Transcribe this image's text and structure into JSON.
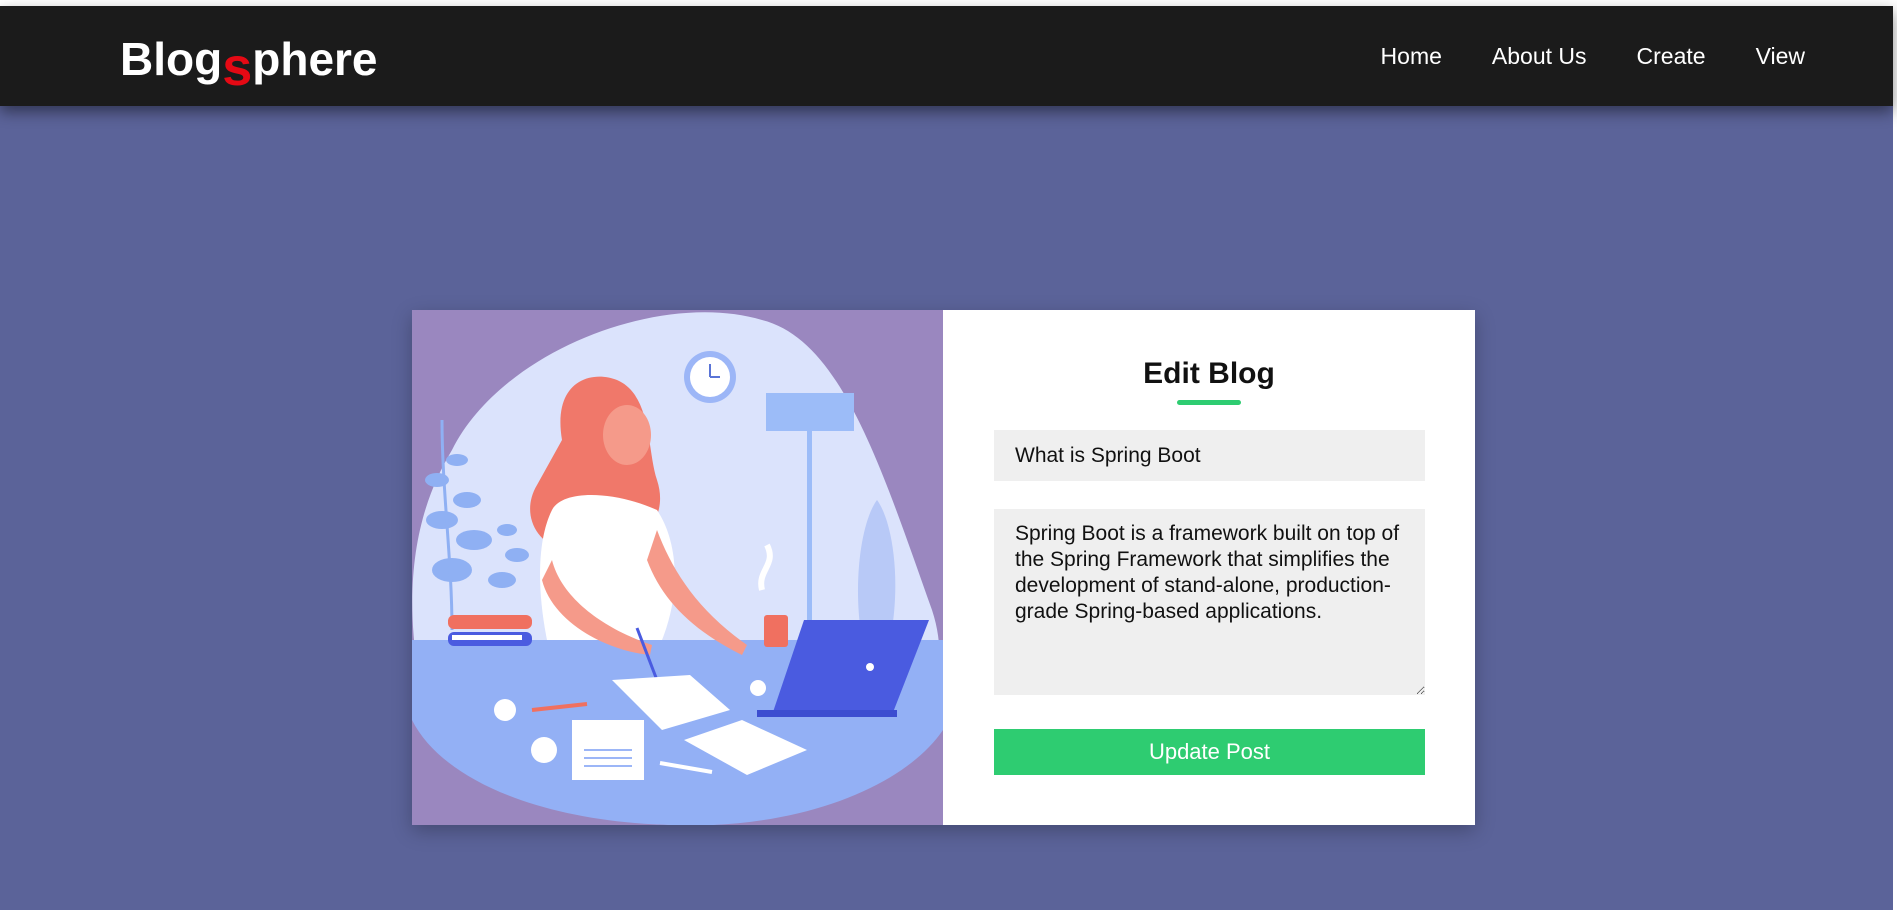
{
  "app": {
    "logo_prefix": "Blog",
    "logo_accent": "s",
    "logo_suffix": "phere"
  },
  "nav": {
    "items": [
      {
        "label": "Home"
      },
      {
        "label": "About Us"
      },
      {
        "label": "Create"
      },
      {
        "label": "View"
      }
    ]
  },
  "form": {
    "heading": "Edit Blog",
    "title_value": "What is Spring Boot",
    "body_value": "Spring Boot is a framework built on top of the Spring Framework that simplifies the development of stand-alone, production-grade Spring-based applications.",
    "submit_label": "Update Post"
  },
  "colors": {
    "page_background": "#5b6399",
    "navbar": "#1b1b1b",
    "logo_accent": "#e50914",
    "accent_green": "#2ecc71",
    "illustration_background": "#9a87bf"
  },
  "illustration": {
    "description_icon": "woman-writing-at-desk-illustration"
  }
}
